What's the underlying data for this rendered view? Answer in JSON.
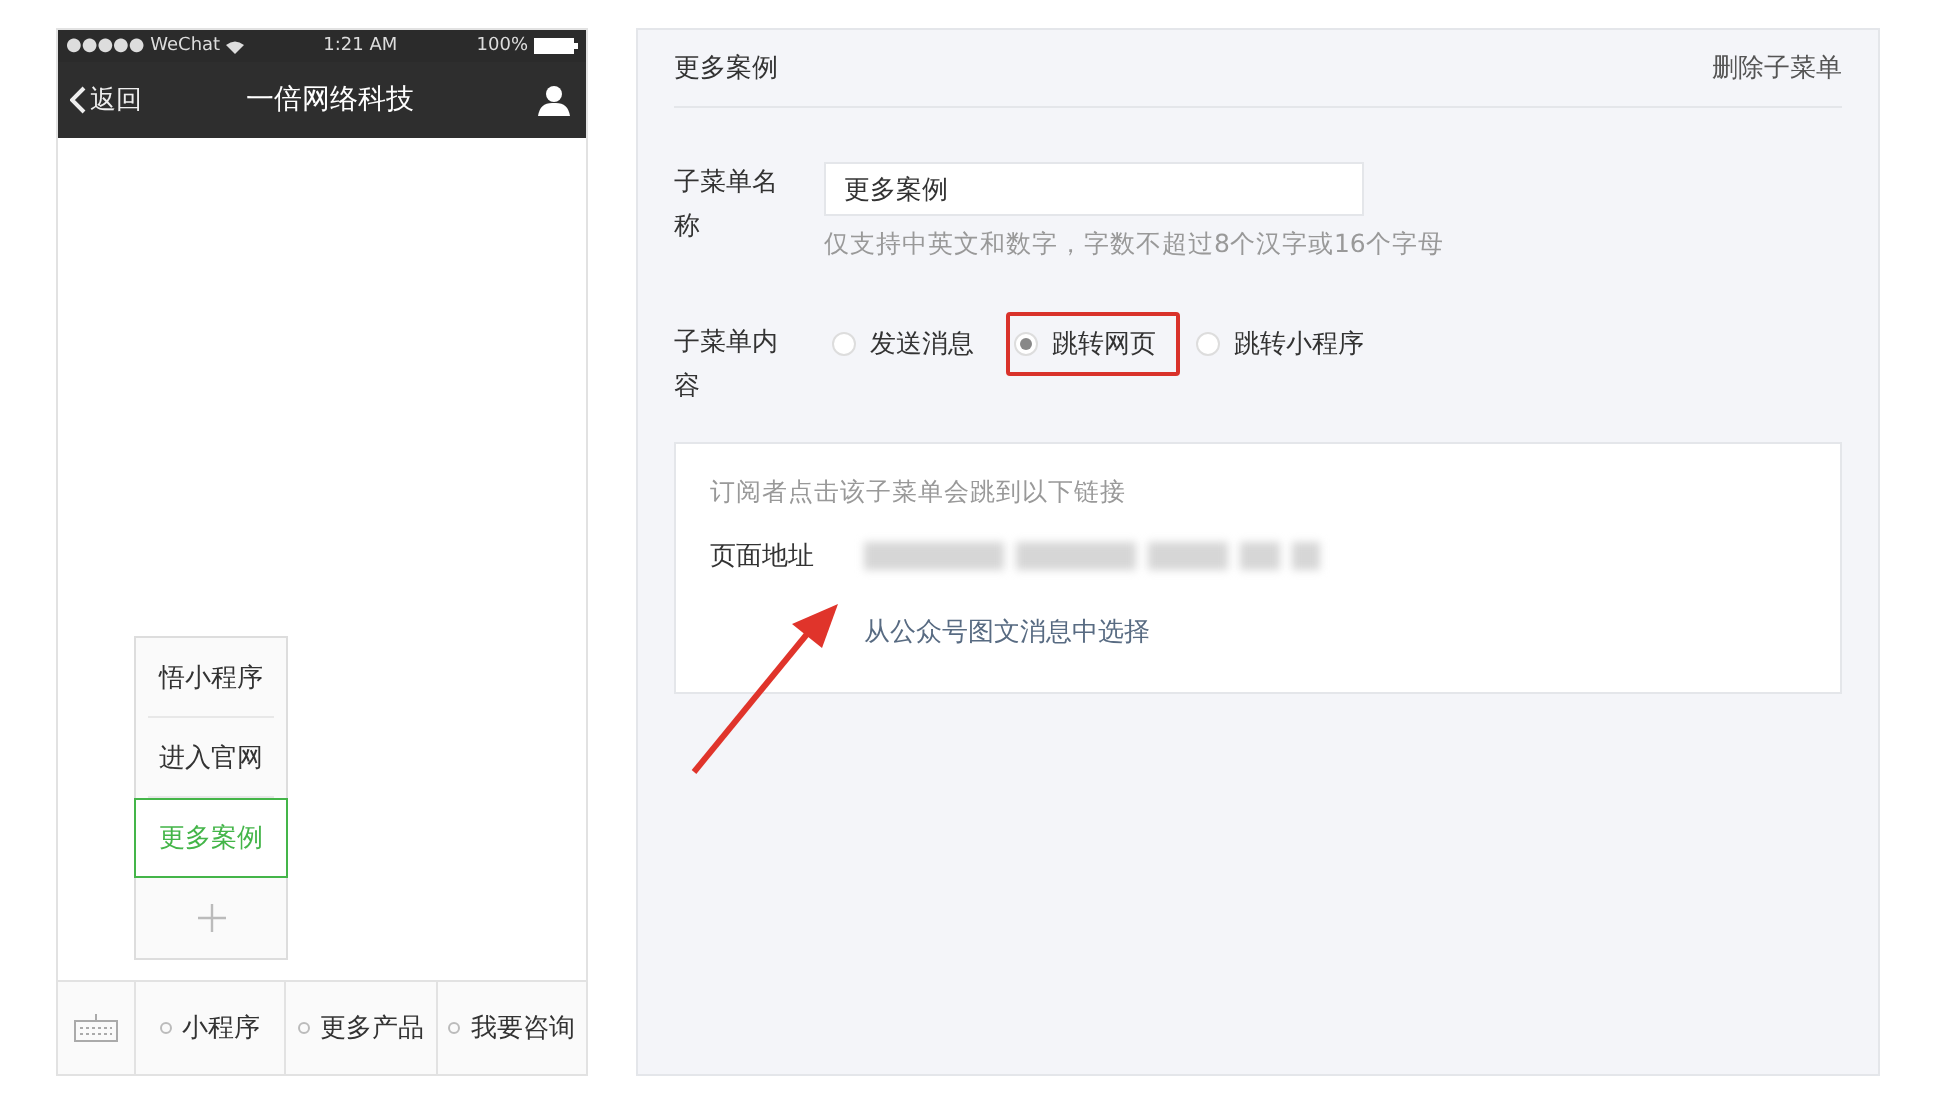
{
  "phone": {
    "status_bar": {
      "carrier": "●●●●● WeChat",
      "time": "1:21 AM",
      "battery": "100%"
    },
    "nav": {
      "back": "返回",
      "title": "一倍网络科技"
    },
    "submenu": [
      {
        "label": "悟小程序",
        "selected": false
      },
      {
        "label": "进入官网",
        "selected": false
      },
      {
        "label": "更多案例",
        "selected": true
      }
    ],
    "menu": [
      {
        "label": "小程序"
      },
      {
        "label": "更多产品"
      },
      {
        "label": "我要咨询"
      }
    ]
  },
  "editor": {
    "title": "更多案例",
    "delete": "删除子菜单",
    "name_label": "子菜单名称",
    "name_value": "更多案例",
    "name_hint": "仅支持中英文和数字，字数不超过8个汉字或16个字母",
    "content_label": "子菜单内容",
    "options": [
      {
        "label": "发送消息",
        "selected": false,
        "highlighted": false
      },
      {
        "label": "跳转网页",
        "selected": true,
        "highlighted": true
      },
      {
        "label": "跳转小程序",
        "selected": false,
        "highlighted": false
      }
    ],
    "link_box": {
      "intro": "订阅者点击该子菜单会跳到以下链接",
      "address_label": "页面地址",
      "pick_link": "从公众号图文消息中选择"
    }
  }
}
